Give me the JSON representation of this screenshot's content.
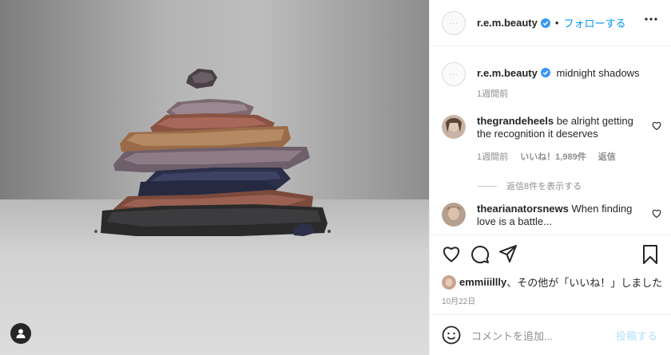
{
  "header": {
    "username": "r.e.m.beauty",
    "separator": "•",
    "follow_label": "フォローする"
  },
  "caption": {
    "username": "r.e.m.beauty",
    "text": "midnight shadows",
    "time": "1週間前"
  },
  "comments": [
    {
      "username": "thegrandeheels",
      "text": "be alright getting the recognition it deserves",
      "time": "1週間前",
      "likes": "いいね！1,989件",
      "reply_label": "返信",
      "view_replies": "返信8件を表示する"
    },
    {
      "username": "thearianatorsnews",
      "text": "When finding love is a battle..."
    }
  ],
  "likes": {
    "username": "emmiiillly",
    "text": "、その他が「いいね！」しました"
  },
  "date": "10月22日",
  "add_comment": {
    "placeholder": "コメントを追加...",
    "post_label": "投稿する"
  },
  "icons": [
    "user-tag-icon",
    "verified-badge-icon",
    "more-options-icon",
    "heart-icon",
    "comment-icon",
    "share-icon",
    "bookmark-icon",
    "emoji-icon"
  ],
  "colors": {
    "link": "#0095f6",
    "verified": "#3897f0",
    "post_disabled": "#b2dffc",
    "meta": "#8e8e8e"
  }
}
